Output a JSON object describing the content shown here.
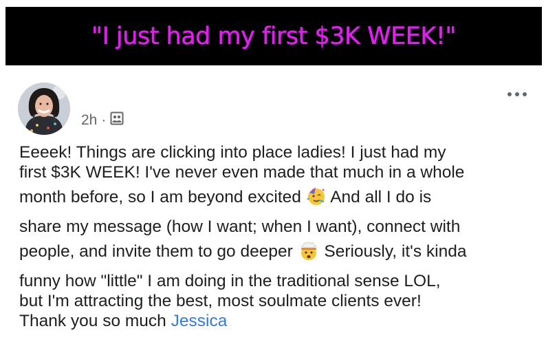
{
  "banner": {
    "text": "\"I just had my first $3K WEEK!\""
  },
  "post": {
    "timestamp": "2h",
    "separator": "·",
    "audience_icon": "group-audience-icon",
    "more_icon": "more-options-icon",
    "lines": [
      "Eeeek! Things are clicking into place ladies! I just had my",
      "first $3K WEEK! I've never even made that much in a whole",
      "month before, so I am beyond excited",
      "And all I do is",
      "share my message (how I want; when I want), connect with",
      "people, and invite them to go deeper",
      "Seriously, it's kinda",
      "funny how \"little\" I am doing in the traditional sense LOL,",
      "but I'm attracting the best, most soulmate clients ever!",
      "Thank you so much"
    ],
    "mention": "Jessica",
    "emojis": [
      "partying-face-emoji",
      "exploding-head-emoji"
    ]
  },
  "colors": {
    "banner_bg": "#000000",
    "banner_text": "#e21df0",
    "body_text": "#1c1e21",
    "meta_text": "#65676b",
    "mention_link": "#3578e5"
  }
}
